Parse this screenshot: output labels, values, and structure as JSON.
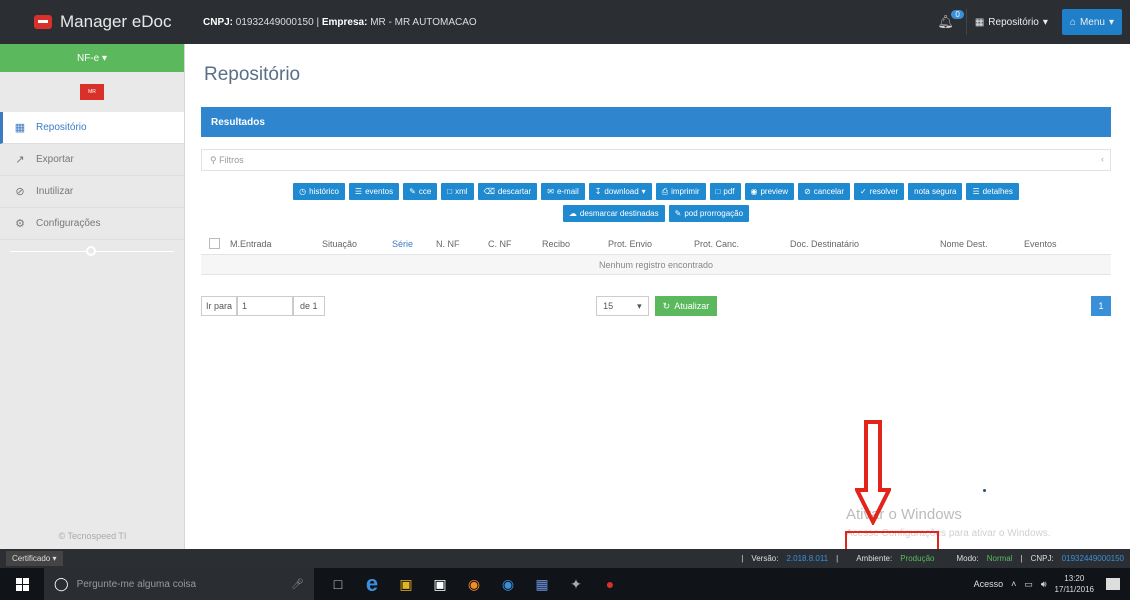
{
  "app": {
    "brand": "Manager eDoc",
    "company_cnpj_label": "CNPJ:",
    "company_cnpj": "01932449000150",
    "company_label": "Empresa:",
    "company_name": "MR - MR AUTOMACAO"
  },
  "topbar": {
    "bell_badge": "0",
    "repositorio_label": "Repositório",
    "menu_label": "Menu"
  },
  "sidebar": {
    "nfe_label": "NF-e",
    "logo_text": "MR",
    "items": [
      {
        "label": "Repositório",
        "icon": "table-icon"
      },
      {
        "label": "Exportar",
        "icon": "export-icon"
      },
      {
        "label": "Inutilizar",
        "icon": "ban-icon"
      },
      {
        "label": "Configurações",
        "icon": "gear-icon"
      }
    ],
    "copyright": "© Tecnospeed TI"
  },
  "main": {
    "title": "Repositório",
    "panel_title": "Resultados",
    "filter_label": "Filtros",
    "buttons_row1": [
      "histórico",
      "eventos",
      "cce",
      "xml",
      "descartar",
      "e-mail",
      "download",
      "imprimir",
      "pdf",
      "preview",
      "cancelar",
      "resolver",
      "nota segura",
      "detalhes"
    ],
    "buttons_row2": [
      "desmarcar destinadas",
      "pod prorrogação"
    ],
    "columns": [
      "M.Entrada",
      "Situação",
      "Série",
      "N. NF",
      "C. NF",
      "Recibo",
      "Prot. Envio",
      "Prot. Canc.",
      "Doc. Destinatário",
      "Nome Dest.",
      "Eventos"
    ],
    "empty_message": "Nenhum registro encontrado",
    "pager": {
      "goto_label": "Ir para",
      "page_value": "1",
      "of_label": "de 1",
      "per_page": "15",
      "refresh_label": "Atualizar",
      "current_page": "1"
    }
  },
  "watermark": {
    "line1": "Ativar o Windows",
    "line2": "Acesse Configurações para ativar o Windows."
  },
  "statusbar": {
    "cert_label": "Certificado",
    "version_label": "Versão:",
    "version_value": "2.018.8.011",
    "env_label": "Ambiente:",
    "env_value": "Produção",
    "mode_label": "Modo:",
    "mode_value": "Normal",
    "cnpj_label": "CNPJ:",
    "cnpj_value": "01932449000150"
  },
  "taskbar": {
    "search_placeholder": "Pergunte-me alguma coisa",
    "tray_label": "Acesso",
    "time": "13:20",
    "date": "17/11/2016"
  },
  "colors": {
    "accent": "#2f86cf",
    "success": "#5cb85c",
    "danger": "#e1251b",
    "topbar": "#2b2f33"
  }
}
